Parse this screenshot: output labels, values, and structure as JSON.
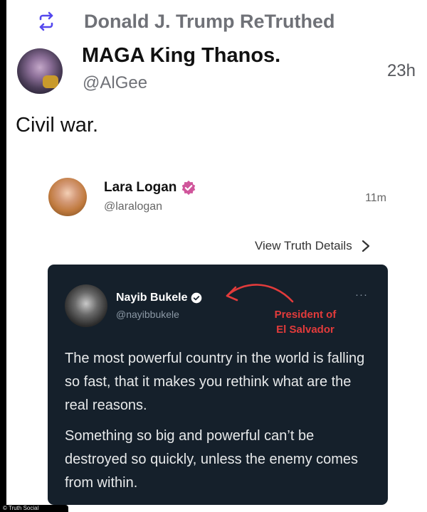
{
  "retruth": {
    "text": "Donald J. Trump ReTruthed",
    "icon": "retruth-icon"
  },
  "post": {
    "author_name": "MAGA King Thanos.",
    "author_handle": "@AlGee",
    "time": "23h",
    "body": "Civil war."
  },
  "quoted_post": {
    "author_name": "Lara Logan",
    "author_handle": "@laralogan",
    "time": "11m",
    "view_details_label": "View Truth Details"
  },
  "embedded_tweet": {
    "author_name": "Nayib Bukele",
    "author_handle": "@nayibbukele",
    "more_label": "···",
    "annotation": {
      "line1": "President of",
      "line2": "El Salvador",
      "color": "#e23b3b"
    },
    "paragraphs": [
      "The most powerful country in the world is falling so fast, that it makes you rethink what are the real reasons.",
      "Something so big and powerful can’t be destroyed so quickly, unless the enemy comes from within."
    ]
  },
  "watermark": "© Truth Social",
  "colors": {
    "accent": "#5448ee",
    "verified_badge": "#d0559b",
    "tweet_bg": "#15202b"
  }
}
